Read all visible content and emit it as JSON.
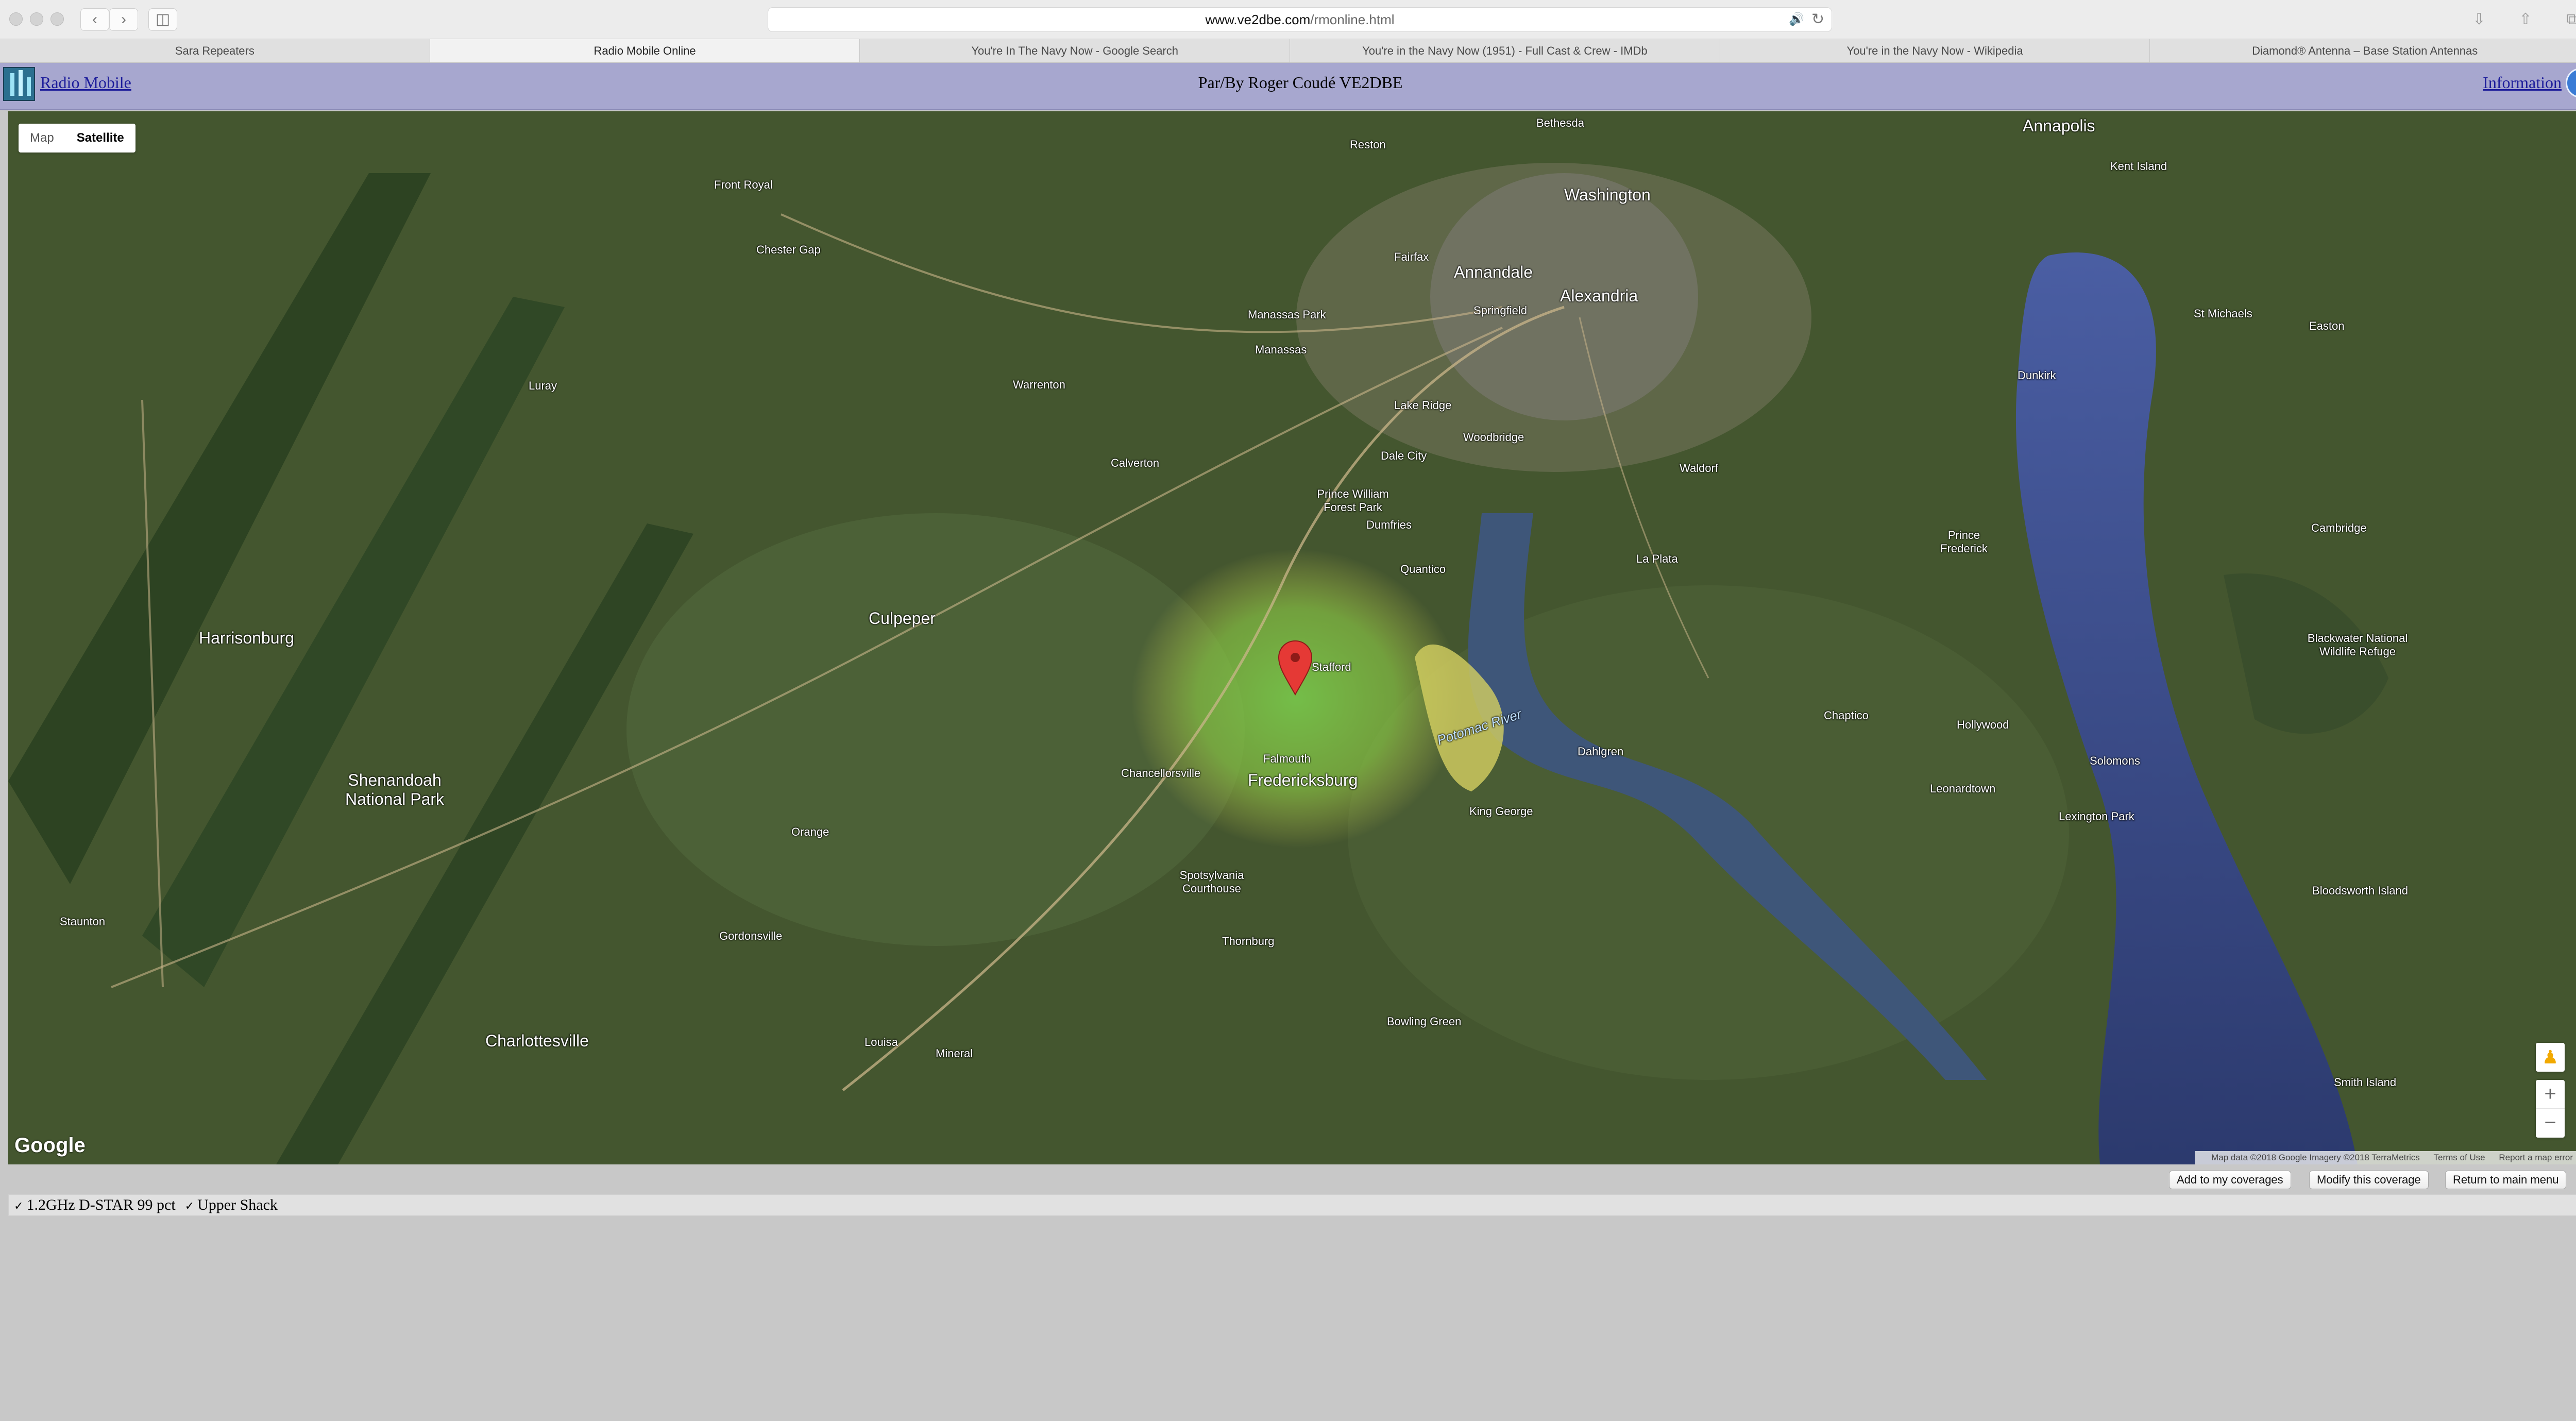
{
  "browser": {
    "url_host": "www.ve2dbe.com",
    "url_path": "/rmonline.html",
    "tabs": [
      "Sara Repeaters",
      "Radio Mobile Online",
      "You're In The Navy Now - Google Search",
      "You're in the Navy Now (1951) - Full Cast & Crew - IMDb",
      "You're in the Navy Now - Wikipedia",
      "Diamond® Antenna – Base Station Antennas"
    ],
    "active_tab": 1
  },
  "header": {
    "brand": "Radio Mobile",
    "byline": "Par/By Roger Coudé VE2DBE",
    "info_link": "Information",
    "info_icon": "i"
  },
  "map": {
    "type_buttons": [
      "Map",
      "Satellite"
    ],
    "active_type": "Satellite",
    "google_logo": "Google",
    "attribution": [
      "Map data ©2018 Google Imagery ©2018 TerraMetrics",
      "Terms of Use",
      "Report a map error"
    ],
    "zoom_in": "+",
    "zoom_out": "−",
    "marker_color": "#e53935",
    "coverage_color": "#7cc74a",
    "water_color": "#3d4f8a",
    "labels": {
      "washington": "Washington",
      "alexandria": "Alexandria",
      "annandale": "Annandale",
      "bethesda": "Bethesda",
      "reston": "Reston",
      "fairfax": "Fairfax",
      "manassas": "Manassas",
      "manassas_park": "Manassas Park",
      "springfield": "Springfield",
      "woodbridge": "Woodbridge",
      "lake_ridge": "Lake Ridge",
      "dale_city": "Dale City",
      "dumfries": "Dumfries",
      "quantico": "Quantico",
      "prince_william_forest_park": "Prince William Forest Park",
      "fredericksburg": "Fredericksburg",
      "falmouth": "Falmouth",
      "chancellorsville": "Chancellorsville",
      "spotsylvania": "Spotsylvania Courthouse",
      "culpeper": "Culpeper",
      "warrenton": "Warrenton",
      "front_royal": "Front Royal",
      "harrisonburg": "Harrisonburg",
      "charlottesville": "Charlottesville",
      "staunton": "Staunton",
      "shenandoah_np": "Shenandoah National Park",
      "orange": "Orange",
      "potomac_river": "Potomac River",
      "annapolis": "Annapolis",
      "kent_island": "Kent Island",
      "waldorf": "Waldorf",
      "la_plata": "La Plata",
      "leonardtown": "Leonardtown",
      "blackwater": "Blackwater National Wildlife Refuge",
      "bloodsworth_island": "Bloodsworth Island",
      "smith_island": "Smith Island",
      "st_michaels": "St Michaels",
      "cambridge": "Cambridge",
      "easton": "Easton",
      "king_george": "King George",
      "dahlgren": "Dahlgren",
      "stafford": "Stafford",
      "thornburg": "Thornburg",
      "bowling_green": "Bowling Green",
      "mineral": "Mineral",
      "louisa": "Louisa",
      "gordonsville": "Gordonsville",
      "luray": "Luray",
      "winchester_area": "Chester Gap",
      "lexington_park": "Lexington Park",
      "solomons": "Solomons",
      "chaptico": "Chaptico",
      "hollywood": "Hollywood",
      "calvert": "Calverton",
      "dunkirk": "Dunkirk",
      "prince_frederick": "Prince Frederick"
    }
  },
  "buttons": {
    "add": "Add to my coverages",
    "modify": "Modify this coverage",
    "return": "Return to main menu"
  },
  "legend": {
    "items": [
      "1.2GHz D-STAR 99 pct",
      "Upper Shack"
    ],
    "check": "✓"
  }
}
